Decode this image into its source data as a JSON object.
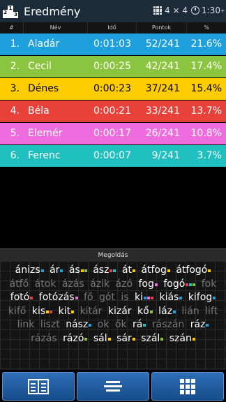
{
  "appbar": {
    "title": "Eredmény",
    "podium_digits": [
      "2",
      "1",
      "3"
    ],
    "grid_size": "4 × 4",
    "timer_value": "1:30",
    "timer_suffix": "+"
  },
  "table": {
    "headers": [
      "#",
      "Név",
      "Idő",
      "Pontok",
      "%"
    ],
    "rows": [
      {
        "rank": "1.",
        "name": "Aladár",
        "time": "0:01:03",
        "points": "52/241",
        "percent": "21.6%",
        "color": "#1ea0dc"
      },
      {
        "rank": "2.",
        "name": "Cecil",
        "time": "0:00:25",
        "points": "42/241",
        "percent": "17.4%",
        "color": "#8bc53f"
      },
      {
        "rank": "3.",
        "name": "Dénes",
        "time": "0:00:23",
        "points": "37/241",
        "percent": "15.4%",
        "color": "#ffcc00"
      },
      {
        "rank": "4.",
        "name": "Béla",
        "time": "0:00:21",
        "points": "33/241",
        "percent": "13.7%",
        "color": "#e8413a"
      },
      {
        "rank": "5.",
        "name": "Elemér",
        "time": "0:00:17",
        "points": "26/241",
        "percent": "10.8%",
        "color": "#ee6cde"
      },
      {
        "rank": "6.",
        "name": "Ferenc",
        "time": "0:00:07",
        "points": "9/241",
        "percent": "3.7%",
        "color": "#20c0c0"
      }
    ]
  },
  "solution": {
    "title": "Megoldás",
    "words": [
      {
        "text": "ánizs",
        "found": true,
        "marks": [
          "#1ea0dc"
        ]
      },
      {
        "text": "ár",
        "found": true,
        "marks": [
          "#1ea0dc"
        ]
      },
      {
        "text": "ás",
        "found": true,
        "marks": [
          "#ffcc00",
          "#8bc53f"
        ]
      },
      {
        "text": "ász",
        "found": true,
        "marks": [
          "#e8413a",
          "#20c0c0"
        ]
      },
      {
        "text": "át",
        "found": true,
        "marks": [
          "#ffcc00"
        ]
      },
      {
        "text": "átfog",
        "found": true,
        "marks": [
          "#ffcc00"
        ]
      },
      {
        "text": "átfogó",
        "found": true,
        "marks": [
          "#ffcc00"
        ]
      },
      {
        "text": "átfő",
        "found": false,
        "marks": []
      },
      {
        "text": "átok",
        "found": false,
        "marks": []
      },
      {
        "text": "ázás",
        "found": false,
        "marks": []
      },
      {
        "text": "ázik",
        "found": false,
        "marks": []
      },
      {
        "text": "ázó",
        "found": false,
        "marks": []
      },
      {
        "text": "fog",
        "found": true,
        "marks": [
          "#ee6cde"
        ]
      },
      {
        "text": "fogó",
        "found": true,
        "marks": [
          "#e8413a",
          "#20c0c0",
          "#8bc53f"
        ]
      },
      {
        "text": "fok",
        "found": false,
        "marks": []
      },
      {
        "text": "fotó",
        "found": true,
        "marks": [
          "#e8413a"
        ]
      },
      {
        "text": "fotózás",
        "found": true,
        "marks": [
          "#ee6cde"
        ]
      },
      {
        "text": "fő",
        "found": false,
        "marks": []
      },
      {
        "text": "gót",
        "found": false,
        "marks": []
      },
      {
        "text": "is",
        "found": false,
        "marks": []
      },
      {
        "text": "ki",
        "found": true,
        "marks": [
          "#1ea0dc",
          "#ee6cde",
          "#e8413a"
        ]
      },
      {
        "text": "kiás",
        "found": true,
        "marks": [
          "#1ea0dc"
        ]
      },
      {
        "text": "kifog",
        "found": true,
        "marks": [
          "#1ea0dc"
        ]
      },
      {
        "text": "kifő",
        "found": false,
        "marks": []
      },
      {
        "text": "kis",
        "found": true,
        "marks": [
          "#ffcc00",
          "#e8413a"
        ]
      },
      {
        "text": "kit",
        "found": true,
        "marks": [
          "#ffcc00"
        ]
      },
      {
        "text": "kitár",
        "found": false,
        "marks": []
      },
      {
        "text": "kizár",
        "found": true,
        "marks": []
      },
      {
        "text": "kő",
        "found": true,
        "marks": [
          "#8bc53f"
        ]
      },
      {
        "text": "láz",
        "found": true,
        "marks": [
          "#1ea0dc"
        ]
      },
      {
        "text": "lián",
        "found": false,
        "marks": []
      },
      {
        "text": "lift",
        "found": false,
        "marks": []
      },
      {
        "text": "link",
        "found": false,
        "marks": []
      },
      {
        "text": "liszt",
        "found": false,
        "marks": []
      },
      {
        "text": "nász",
        "found": true,
        "marks": [
          "#1ea0dc"
        ]
      },
      {
        "text": "ok",
        "found": false,
        "marks": []
      },
      {
        "text": "ők",
        "found": false,
        "marks": []
      },
      {
        "text": "rá",
        "found": true,
        "marks": [
          "#20c0c0"
        ]
      },
      {
        "text": "rászán",
        "found": false,
        "marks": []
      },
      {
        "text": "ráz",
        "found": true,
        "marks": [
          "#1ea0dc"
        ]
      },
      {
        "text": "rázás",
        "found": false,
        "marks": []
      },
      {
        "text": "rázó",
        "found": true,
        "marks": [
          "#8bc53f"
        ]
      },
      {
        "text": "sál",
        "found": true,
        "marks": [
          "#ffcc00"
        ]
      },
      {
        "text": "sár",
        "found": true,
        "marks": [
          "#ffcc00"
        ]
      },
      {
        "text": "szál",
        "found": true,
        "marks": [
          "#8bc53f"
        ]
      },
      {
        "text": "szán",
        "found": true,
        "marks": [
          "#ffcc00"
        ]
      }
    ]
  },
  "footer": {
    "buttons": [
      {
        "icon": "book-icon"
      },
      {
        "icon": "align-center-icon"
      },
      {
        "icon": "grid-icon"
      }
    ]
  }
}
